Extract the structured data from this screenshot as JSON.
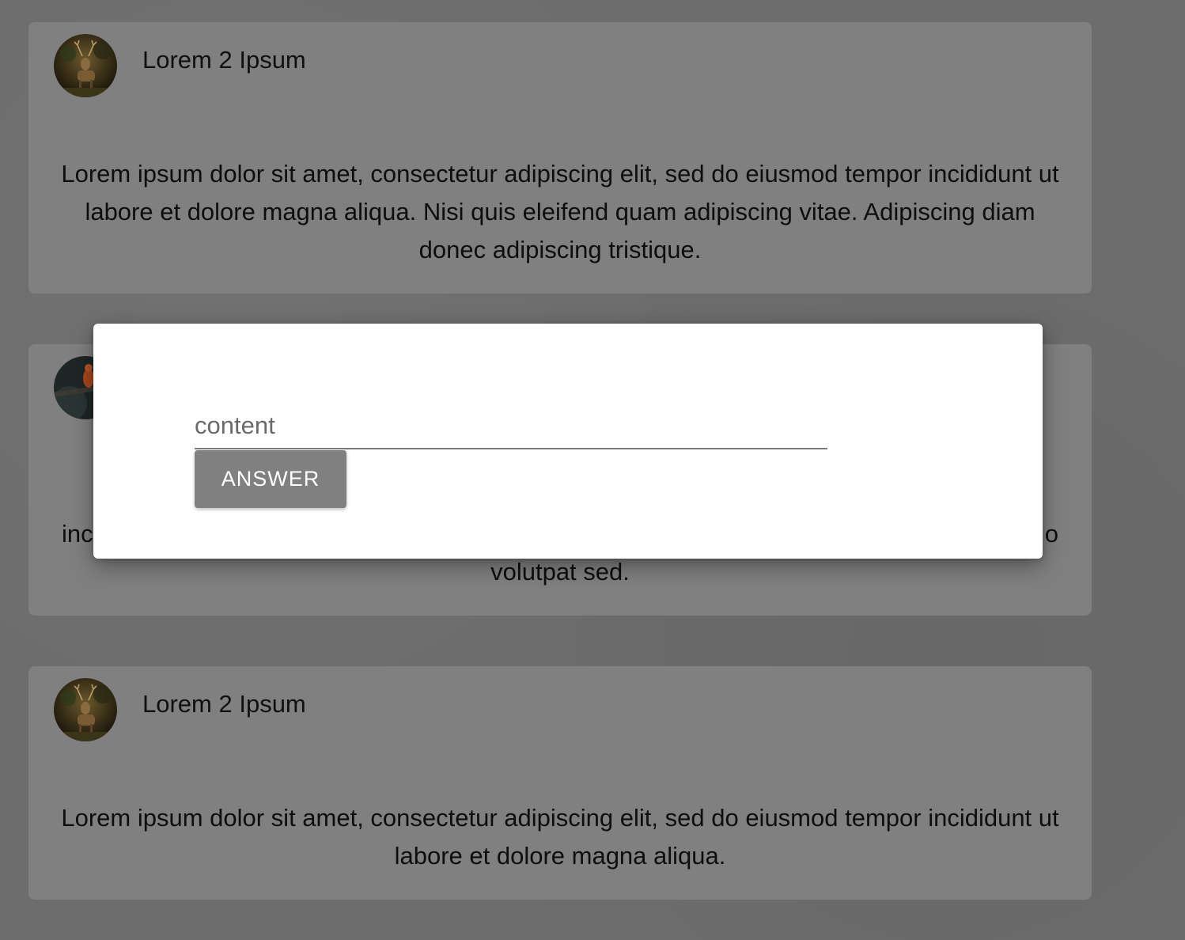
{
  "cards": [
    {
      "author": "Lorem 2 Ipsum",
      "avatar_icon": "deer-avatar",
      "body": "Lorem ipsum dolor sit amet, consectetur adipiscing elit, sed do eiusmod tempor incididunt ut labore et dolore magna aliqua. Nisi quis eleifend quam adipiscing vitae. Adipiscing diam donec adipiscing tristique."
    },
    {
      "author": "",
      "avatar_icon": "bird-avatar",
      "body_left_fragment": "inc",
      "body_right_fragment": "o",
      "body_last_line": "volutpat sed."
    },
    {
      "author": "Lorem 2 Ipsum",
      "avatar_icon": "deer-avatar",
      "body": "Lorem ipsum dolor sit amet, consectetur adipiscing elit, sed do eiusmod tempor incididunt ut labore et dolore magna aliqua."
    }
  ],
  "modal": {
    "input_placeholder": "content",
    "button_label": "ANSWER"
  },
  "colors": {
    "background": "#6d6d6d",
    "card": "#808080",
    "modal": "#ffffff",
    "button": "#808080"
  }
}
